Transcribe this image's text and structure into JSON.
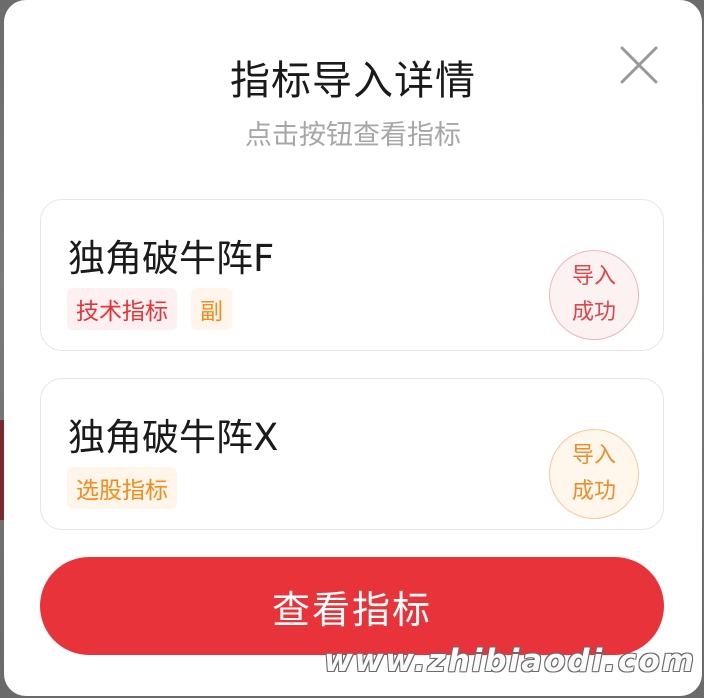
{
  "dialog": {
    "title": "指标导入详情",
    "subtitle": "点击按钮查看指标",
    "close_icon": "close-icon"
  },
  "items": [
    {
      "name": "独角破牛阵F",
      "tags": [
        {
          "label": "技术指标",
          "color": "#e5333a"
        },
        {
          "label": "副",
          "color": "#f28c1a"
        }
      ],
      "status": "导入\n成功",
      "status_color": "#e0454a"
    },
    {
      "name": "独角破牛阵X",
      "tags": [
        {
          "label": "选股指标",
          "color": "#f28c1a"
        }
      ],
      "status": "导入\n成功",
      "status_color": "#ef8d2a"
    }
  ],
  "actions": {
    "primary_label": "查看指标",
    "primary_color": "#e8333a"
  },
  "watermark": "www.zhibiaodi.com"
}
